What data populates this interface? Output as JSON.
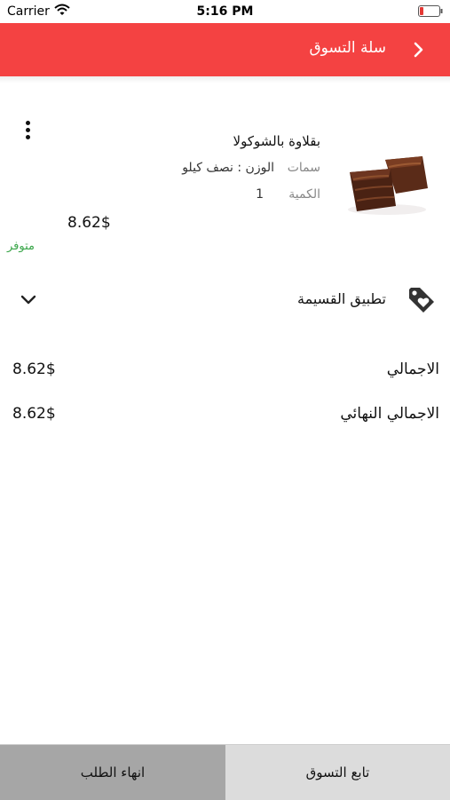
{
  "status_bar": {
    "carrier": "Carrier",
    "time": "5:16 PM"
  },
  "header": {
    "title": "سلة التسوق"
  },
  "cart_item": {
    "name": "بقلاوة بالشوكولا",
    "attributes_label": "سمات",
    "attributes_value": "الوزن : نصف كيلو",
    "quantity_label": "الكمية",
    "quantity_value": "1",
    "price": "8.62$",
    "availability": "متوفر"
  },
  "coupon": {
    "label": "تطبيق القسيمة"
  },
  "totals": [
    {
      "label": "الاجمالي",
      "value": "8.62$"
    },
    {
      "label": "الاجمالي النهائي",
      "value": "8.62$"
    }
  ],
  "footer": {
    "checkout_label": "انهاء الطلب",
    "continue_label": "تابع التسوق"
  },
  "colors": {
    "header": "#f44242",
    "available": "#3aa64a",
    "checkout_bg": "#a6a6a6",
    "continue_bg": "#dcdcdc"
  },
  "icons": [
    "wifi-icon",
    "battery-icon",
    "chevron-right-icon",
    "more-vertical-icon",
    "tag-icon",
    "chevron-down-icon"
  ]
}
